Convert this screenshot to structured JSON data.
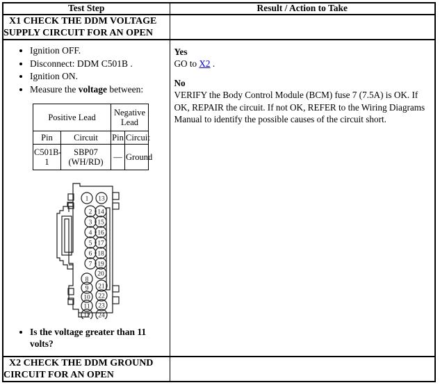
{
  "table": {
    "headers": {
      "test_step": "Test Step",
      "result_action": "Result / Action to Take"
    }
  },
  "step_x1": {
    "title_line1": "X1 CHECK THE DDM VOLTAGE",
    "title_line2": "SUPPLY CIRCUIT FOR AN OPEN",
    "bullets": [
      "Ignition OFF.",
      "Disconnect: DDM C501B .",
      "Ignition ON.",
      "Measure the "
    ],
    "bullet4_bold": "voltage",
    "bullet4_tail": " between:",
    "question": "Is the voltage greater than 11 volts?",
    "leads_table": {
      "group_positive": "Positive Lead",
      "group_negative_line1": "Negative",
      "group_negative_line2": "Lead",
      "col_pin_pos": "Pin",
      "col_circuit_pos": "Circuit",
      "col_pin_neg": "Pin",
      "col_circuit_neg": "Circuit",
      "row": {
        "pin_pos_line1": "C501B-",
        "pin_pos_line2": "1",
        "circuit_pos_line1": "SBP07",
        "circuit_pos_line2": "(WH/RD)",
        "pin_neg": "—",
        "circuit_neg": "Ground"
      }
    },
    "connector": {
      "name": "DDM C501B connector pin view",
      "pins_left_top": [
        "1"
      ],
      "pins_right_top": [
        "13"
      ],
      "pins_left_mid": [
        "2",
        "3",
        "4",
        "5",
        "6",
        "7"
      ],
      "pins_right_mid": [
        "14",
        "15",
        "16",
        "17",
        "18",
        "19",
        "20"
      ],
      "pins_left_bottom": [
        "8",
        "9",
        "10",
        "11",
        "12"
      ],
      "pins_right_bottom": [
        "21",
        "22",
        "23",
        "24"
      ]
    },
    "result": {
      "yes_label": "Yes",
      "yes_text_pre": "GO to ",
      "yes_link": "X2",
      "yes_text_post": " .",
      "no_label": "No",
      "no_text": "VERIFY the Body Control Module (BCM) fuse 7 (7.5A) is OK. If OK, REPAIR the circuit. If not OK, REFER to the Wiring Diagrams Manual to identify the possible causes of the circuit short."
    }
  },
  "step_x2": {
    "title_line1": "X2 CHECK THE DDM GROUND",
    "title_line2": "CIRCUIT FOR AN OPEN"
  },
  "colors": {
    "link": "#0000cc",
    "border": "#000000",
    "background": "#ffffff",
    "diagram_line": "#1a1a1a"
  }
}
